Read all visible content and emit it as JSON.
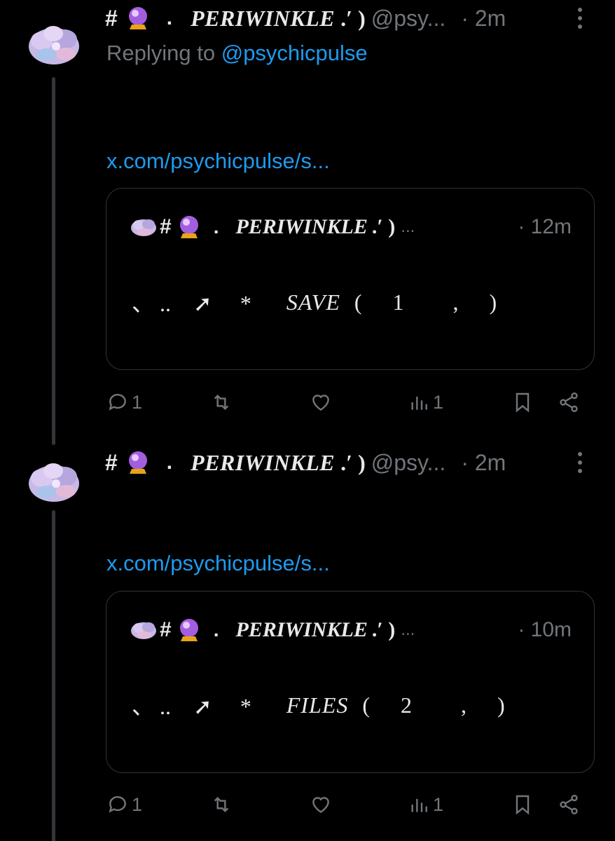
{
  "colors": {
    "background": "#000000",
    "text_primary": "#e7e9ea",
    "text_secondary": "#71767b",
    "link": "#1d9bf0",
    "border": "#2f3336",
    "thread_line": "#333639"
  },
  "tweets": [
    {
      "author": {
        "name_prefix": "#",
        "emoji": "crystal-ball",
        "separator": ".",
        "display_name": "PERIWINKLE",
        "name_suffix": ".′ )",
        "handle": "@psy...",
        "avatar_icon": "cloud-collage-avatar"
      },
      "time": "· 2m",
      "replying_prefix": "Replying to ",
      "replying_to": "@psychicpulse",
      "link_text": "x.com/psychicpulse/s...",
      "quote": {
        "prefix": "#",
        "emoji": "crystal-ball",
        "separator": ".",
        "display_name": "PERIWINKLE",
        "name_suffix": ".′ )",
        "ellipsis": "...",
        "time": "· 12m",
        "body_marks": "、 ..    ➚     *",
        "keyword": "SAVE",
        "paren_text": "( 1  , )"
      },
      "stats": {
        "replies": "1",
        "retweets": "",
        "likes": "",
        "views": "1"
      }
    },
    {
      "author": {
        "name_prefix": "#",
        "emoji": "crystal-ball",
        "separator": ".",
        "display_name": "PERIWINKLE",
        "name_suffix": ".′ )",
        "handle": "@psy...",
        "avatar_icon": "cloud-collage-avatar"
      },
      "time": "· 2m",
      "link_text": "x.com/psychicpulse/s...",
      "quote": {
        "prefix": "#",
        "emoji": "crystal-ball",
        "separator": ".",
        "display_name": "PERIWINKLE",
        "name_suffix": ".′ )",
        "ellipsis": "...",
        "time": "· 10m",
        "body_marks": "、 ..    ➚     *",
        "keyword": "FILES",
        "paren_text": "( 2  , )"
      },
      "stats": {
        "replies": "1",
        "retweets": "",
        "likes": "",
        "views": "1"
      }
    }
  ]
}
